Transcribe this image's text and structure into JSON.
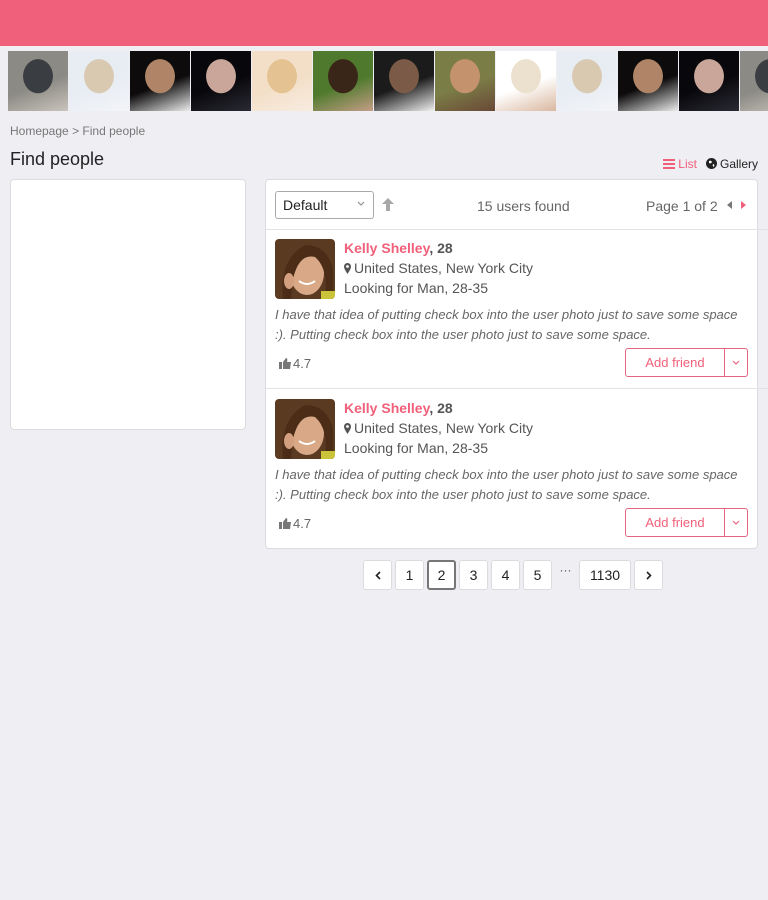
{
  "header": {
    "brand_color": "#f0607a"
  },
  "photo_strip": {
    "thumbnails": [
      {
        "label": "man-leaning-wall",
        "colors": [
          "#8c8a84",
          "#3a3d42",
          "#c9c4bd"
        ]
      },
      {
        "label": "blonde-woman-bed",
        "colors": [
          "#e8ecf3",
          "#d8c9b0",
          "#f3f5f8"
        ]
      },
      {
        "label": "smiling-man-black-bg",
        "colors": [
          "#0d0b0b",
          "#b08466",
          "#ececec"
        ]
      },
      {
        "label": "dark-haired-woman",
        "colors": [
          "#08080c",
          "#c9a59a",
          "#2a2a33"
        ]
      },
      {
        "label": "blonde-woman-closeup",
        "colors": [
          "#f3dfc8",
          "#e5c291",
          "#f8ece0"
        ]
      },
      {
        "label": "brunette-woman-green",
        "colors": [
          "#4f7a2d",
          "#3a2618",
          "#c49d86"
        ]
      },
      {
        "label": "man-leather-jacket",
        "colors": [
          "#1b1b1b",
          "#7b5a47",
          "#f0f0f0"
        ]
      },
      {
        "label": "man-brown-scarf",
        "colors": [
          "#7b7d47",
          "#c4936e",
          "#6a4836"
        ]
      },
      {
        "label": "platinum-blonde-woman",
        "colors": [
          "#ffffff",
          "#ece1cf",
          "#d9b79f"
        ]
      },
      {
        "label": "blonde-woman-bed",
        "colors": [
          "#e8ecf3",
          "#d8c9b0",
          "#f3f5f8"
        ]
      },
      {
        "label": "smiling-man-black-bg",
        "colors": [
          "#0d0b0b",
          "#b08466",
          "#ececec"
        ]
      },
      {
        "label": "dark-haired-woman",
        "colors": [
          "#08080c",
          "#c9a59a",
          "#2a2a33"
        ]
      },
      {
        "label": "man-leaning-wall",
        "colors": [
          "#8c8a84",
          "#3a3d42",
          "#c9c4bd"
        ]
      }
    ]
  },
  "breadcrumb": {
    "home": "Homepage",
    "separator": ">",
    "current": "Find people"
  },
  "page_title": "Find people",
  "view_toggle": {
    "list_label": "List",
    "gallery_label": "Gallery",
    "active": "list"
  },
  "results": {
    "sort": {
      "selected": "Default",
      "direction": "ascending"
    },
    "found_text": "15 users found",
    "pager_text": "Page 1 of 2",
    "items": [
      {
        "name": "Kelly Shelley",
        "age_suffix": ", 28",
        "location": "United States, New York City",
        "looking_for": "Looking for Man, 28-35",
        "bio": "I have that idea of putting check box into the user photo just to save some space :). Putting check box into the user photo just to save some space.",
        "rating": "4.7",
        "action_label": "Add friend"
      },
      {
        "name": "Kelly Shelley",
        "age_suffix": ", 28",
        "location": "United States, New York City",
        "looking_for": "Looking for Man, 28-35",
        "bio": "I have that idea of putting check box into the user photo just to save some space :). Putting check box into the user photo just to save some space.",
        "rating": "4.7",
        "action_label": "Add friend"
      }
    ]
  },
  "pagination": {
    "pages": [
      "1",
      "2",
      "3",
      "4",
      "5"
    ],
    "current": "2",
    "ellipsis": "···",
    "last": "1130"
  }
}
